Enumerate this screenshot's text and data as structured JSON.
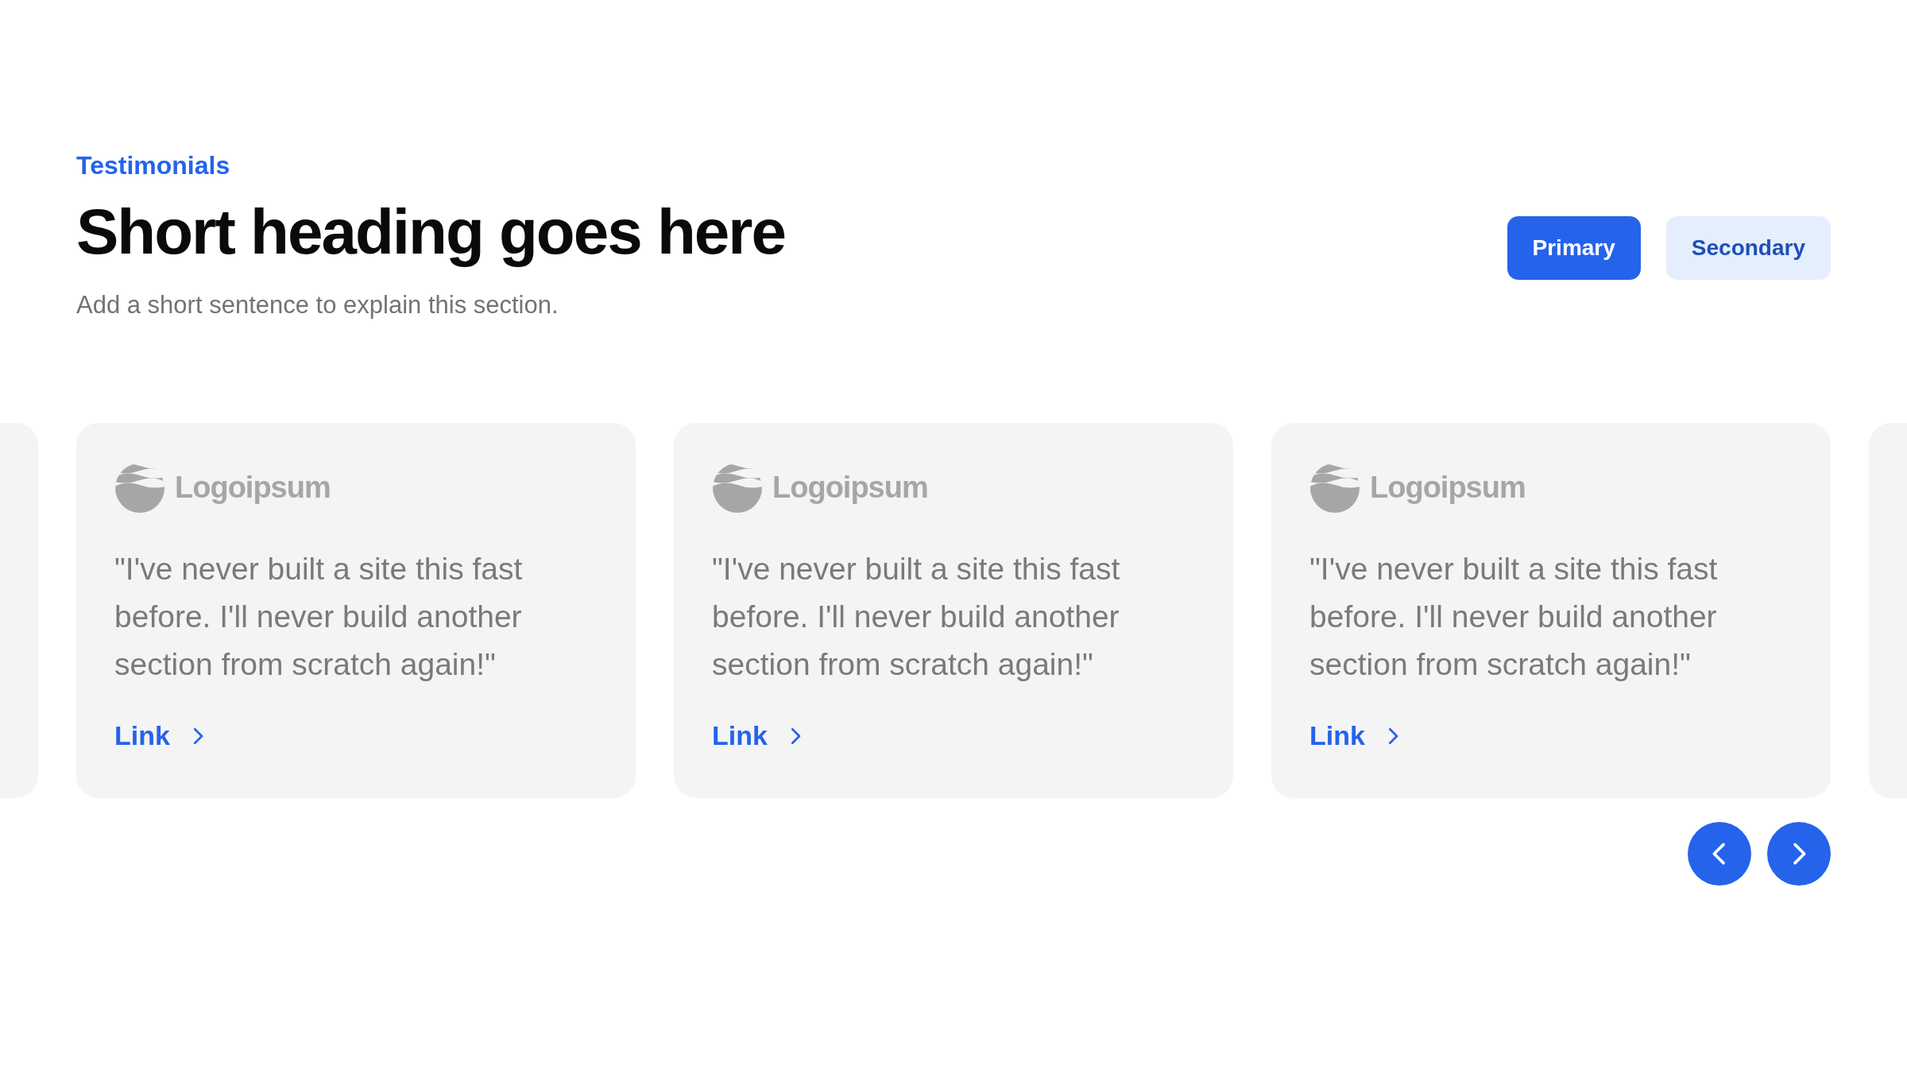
{
  "section": {
    "eyebrow": "Testimonials",
    "heading": "Short heading goes here",
    "subtitle": "Add a short sentence to explain this section."
  },
  "actions": [
    {
      "label": "Primary",
      "kind": "primary"
    },
    {
      "label": "Secondary",
      "kind": "secondary"
    }
  ],
  "testimonials": [
    {
      "logo": "Logoipsum",
      "quote": "\"I've never built a site this fast before. I'll never build another section from scratch again!\"",
      "link": "Link"
    },
    {
      "logo": "Logoipsum",
      "quote": "\"I've never built a site this fast before. I'll never build another section from scratch again!\"",
      "link": "Link"
    },
    {
      "logo": "Logoipsum",
      "quote": "\"I've never built a site this fast before. I'll never build another section from scratch again!\"",
      "link": "Link"
    }
  ]
}
